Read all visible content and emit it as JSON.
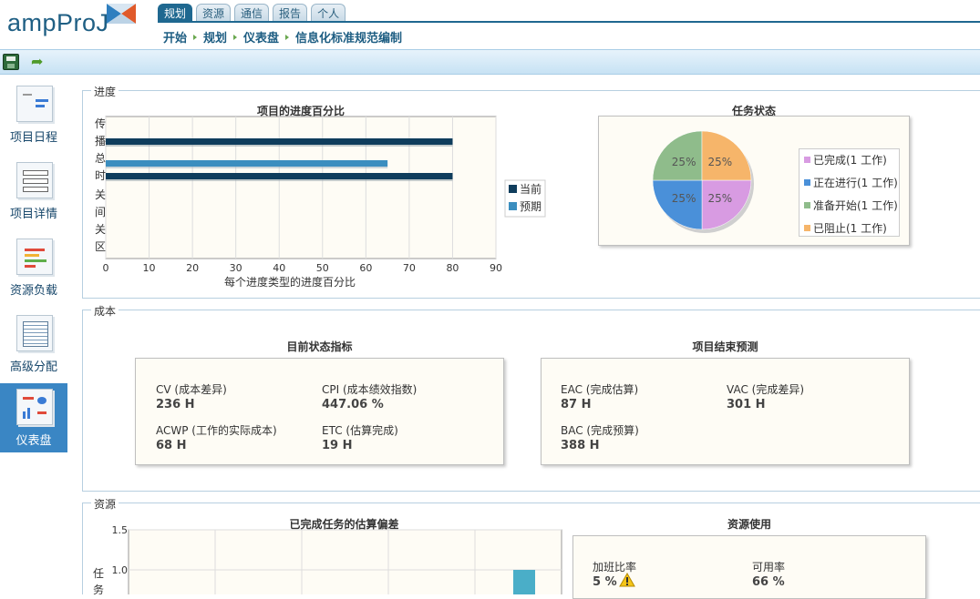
{
  "app": {
    "logo_text": "ampProJ"
  },
  "tabs": [
    {
      "label": "规划",
      "active": true
    },
    {
      "label": "资源",
      "active": false
    },
    {
      "label": "通信",
      "active": false
    },
    {
      "label": "报告",
      "active": false
    },
    {
      "label": "个人",
      "active": false
    }
  ],
  "breadcrumb": [
    "开始",
    "规划",
    "仪表盘",
    "信息化标准规范编制"
  ],
  "toolbar": {
    "save_icon": "save-icon",
    "refresh_icon": "refresh-icon"
  },
  "sidebar": {
    "items": [
      {
        "label": "项目日程",
        "icon": "project-schedule-icon",
        "active": false
      },
      {
        "label": "项目详情",
        "icon": "project-details-icon",
        "active": false
      },
      {
        "label": "资源负载",
        "icon": "resource-load-icon",
        "active": false
      },
      {
        "label": "高级分配",
        "icon": "advanced-allocation-icon",
        "active": false
      },
      {
        "label": "仪表盘",
        "icon": "dashboard-icon",
        "active": true
      }
    ]
  },
  "sections": {
    "progress": "进度",
    "cost": "成本",
    "resources": "资源"
  },
  "progress_chart": {
    "title": "项目的进度百分比",
    "xlabel": "每个进度类型的进度百分比",
    "y_labels": [
      "传播",
      "总时",
      "关间",
      "关区"
    ],
    "x_ticks": [
      "0",
      "10",
      "20",
      "30",
      "40",
      "50",
      "60",
      "70",
      "80",
      "90"
    ],
    "legend": [
      "当前",
      "预期"
    ]
  },
  "task_status": {
    "title": "任务状态",
    "legend": [
      "已完成(1 工作)",
      "正在进行(1 工作)",
      "准备开始(1 工作)",
      "已阻止(1 工作)"
    ],
    "slice_labels": [
      "25%",
      "25%",
      "25%",
      "25%"
    ]
  },
  "current_status": {
    "title": "目前状态指标",
    "metrics": [
      {
        "label": "CV (成本差异)",
        "value": "236 H"
      },
      {
        "label": "CPI (成本绩效指数)",
        "value": "447.06 %"
      },
      {
        "label": "ACWP (工作的实际成本)",
        "value": "68 H"
      },
      {
        "label": "ETC (估算完成)",
        "value": "19 H"
      }
    ]
  },
  "forecast": {
    "title": "项目结束预测",
    "metrics": [
      {
        "label": "EAC (完成估算)",
        "value": "87 H"
      },
      {
        "label": "VAC (完成差异)",
        "value": "301 H"
      },
      {
        "label": "BAC (完成预算)",
        "value": "388 H"
      }
    ]
  },
  "estimate_chart": {
    "title": "已完成任务的估算偏差",
    "y_ticks": [
      "1.5",
      "1.0"
    ],
    "ylabel": "任务"
  },
  "resource_usage": {
    "title": "资源使用",
    "metrics": [
      {
        "label": "加班比率",
        "value": "5 %",
        "warning": true
      },
      {
        "label": "可用率",
        "value": "66 %"
      }
    ]
  },
  "chart_data": [
    {
      "type": "bar",
      "orientation": "horizontal",
      "title": "项目的进度百分比",
      "xlabel": "每个进度类型的进度百分比",
      "ylabel": "",
      "categories": [
        "传播",
        "总时"
      ],
      "series": [
        {
          "name": "当前",
          "values": [
            80,
            80
          ],
          "color": "#0f3d5c"
        },
        {
          "name": "预期",
          "values": [
            null,
            65
          ],
          "color": "#3b8ebf"
        }
      ],
      "xlim": [
        0,
        90
      ],
      "grid": true,
      "legend": "right"
    },
    {
      "type": "pie",
      "title": "任务状态",
      "categories": [
        "已完成(1 工作)",
        "正在进行(1 工作)",
        "准备开始(1 工作)",
        "已阻止(1 工作)"
      ],
      "values": [
        25,
        25,
        25,
        25
      ],
      "colors": [
        "#d89be2",
        "#4a90d9",
        "#8fbc8b",
        "#f6b56a"
      ],
      "legend": "right"
    },
    {
      "type": "bar",
      "title": "已完成任务的估算偏差",
      "ylabel": "任务",
      "ylim": [
        0,
        1.5
      ],
      "values": [
        1.0
      ],
      "color": "#4aaec8",
      "grid": true
    }
  ]
}
